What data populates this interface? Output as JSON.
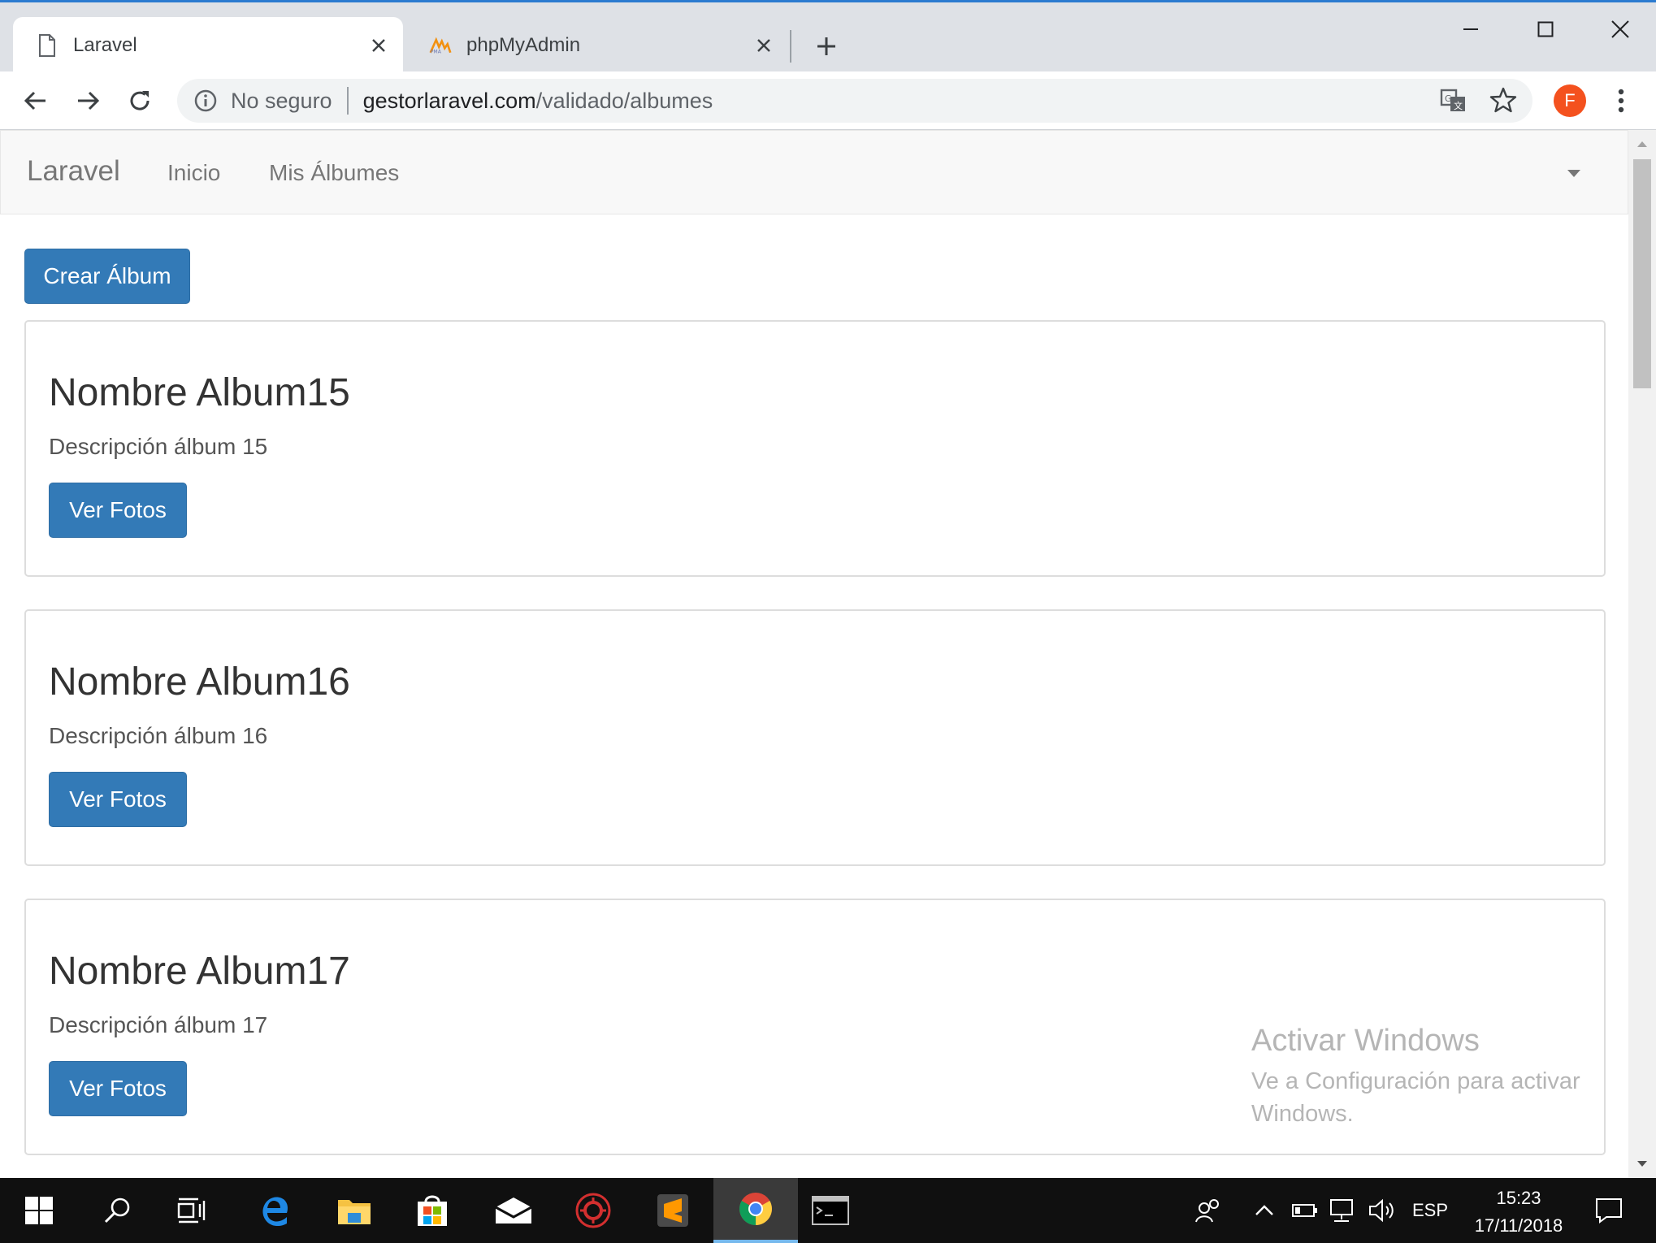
{
  "browser": {
    "tabs": [
      {
        "title": "Laravel",
        "active": true
      },
      {
        "title": "phpMyAdmin",
        "active": false
      }
    ],
    "address_bar": {
      "security_label": "No seguro",
      "url_host": "gestorlaravel.com",
      "url_path": "/validado/albumes"
    },
    "profile_initial": "F"
  },
  "navbar": {
    "brand": "Laravel",
    "links": [
      "Inicio",
      "Mis Álbumes"
    ]
  },
  "actions": {
    "create_album": "Crear Álbum"
  },
  "albums": [
    {
      "title": "Nombre Album15",
      "description": "Descripción álbum 15",
      "button": "Ver Fotos"
    },
    {
      "title": "Nombre Album16",
      "description": "Descripción álbum 16",
      "button": "Ver Fotos"
    },
    {
      "title": "Nombre Album17",
      "description": "Descripción álbum 17",
      "button": "Ver Fotos"
    }
  ],
  "watermark": {
    "title": "Activar Windows",
    "subtitle": "Ve a Configuración para activar Windows."
  },
  "taskbar": {
    "apps": [
      "start-icon",
      "search-icon",
      "task-view-icon",
      "edge-icon",
      "file-explorer-icon",
      "store-icon",
      "mail-icon",
      "antivirus-icon",
      "sublime-text-icon",
      "chrome-icon",
      "terminal-icon"
    ],
    "tray": {
      "language": "ESP",
      "time": "15:23",
      "date": "17/11/2018"
    }
  },
  "colors": {
    "primary_button": "#337ab7",
    "navbar_bg": "#f8f8f8",
    "tab_strip": "#dee1e6",
    "taskbar": "#101010"
  }
}
